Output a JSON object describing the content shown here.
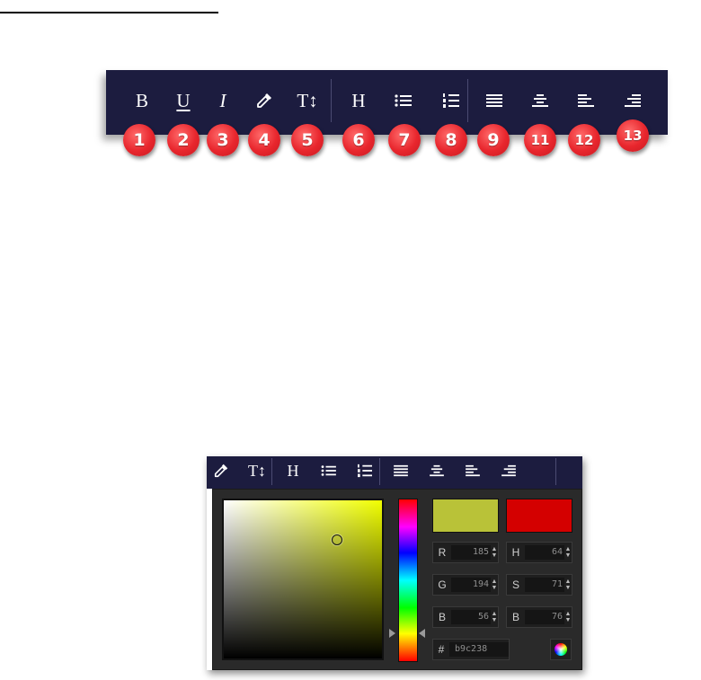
{
  "main_toolbar": {
    "buttons": [
      {
        "label": "B",
        "badge": "1"
      },
      {
        "label": "U",
        "badge": "2"
      },
      {
        "label": "I",
        "badge": "3"
      },
      {
        "icon": "eyedropper-icon",
        "badge": "4"
      },
      {
        "label": "T↕",
        "badge": "5"
      },
      {
        "label": "H",
        "badge": "6"
      },
      {
        "icon": "bulleted-list-icon",
        "badge": "7"
      },
      {
        "icon": "numbered-list-icon",
        "badge": "8"
      },
      {
        "icon": "align-justify-icon",
        "badge": "9"
      },
      {
        "icon": "align-center-icon",
        "badge": "11"
      },
      {
        "icon": "align-left-icon",
        "badge": "12"
      },
      {
        "icon": "align-right-icon",
        "badge": "13"
      }
    ]
  },
  "mini_toolbar": {
    "font_size_label": "T↕",
    "heading_label": "H"
  },
  "color_picker": {
    "new_color": "#b9c238",
    "current_color": "#d40000",
    "rgb": {
      "r_label": "R",
      "r": "185",
      "g_label": "G",
      "g": "194",
      "b_label": "B",
      "b": "56"
    },
    "hsb": {
      "h_label": "H",
      "h": "64",
      "s_label": "S",
      "s": "71",
      "b_label": "B",
      "b": "76"
    },
    "hex_label": "#",
    "hex": "b9c238"
  },
  "colors": {
    "toolbar_bg": "#1c1c3f",
    "badge_red": "#e8262d",
    "panel_bg": "#2a2a2a"
  }
}
